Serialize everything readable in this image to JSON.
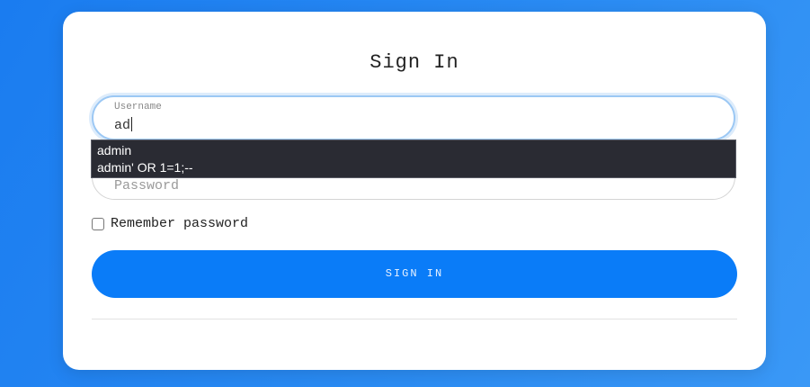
{
  "form": {
    "title": "Sign In",
    "username": {
      "label": "Username",
      "value": "ad"
    },
    "password": {
      "placeholder": "Password"
    },
    "autocomplete": {
      "options": [
        "admin",
        "admin' OR 1=1;--"
      ]
    },
    "remember": {
      "label": "Remember password",
      "checked": false
    },
    "submit_label": "SIGN IN"
  }
}
